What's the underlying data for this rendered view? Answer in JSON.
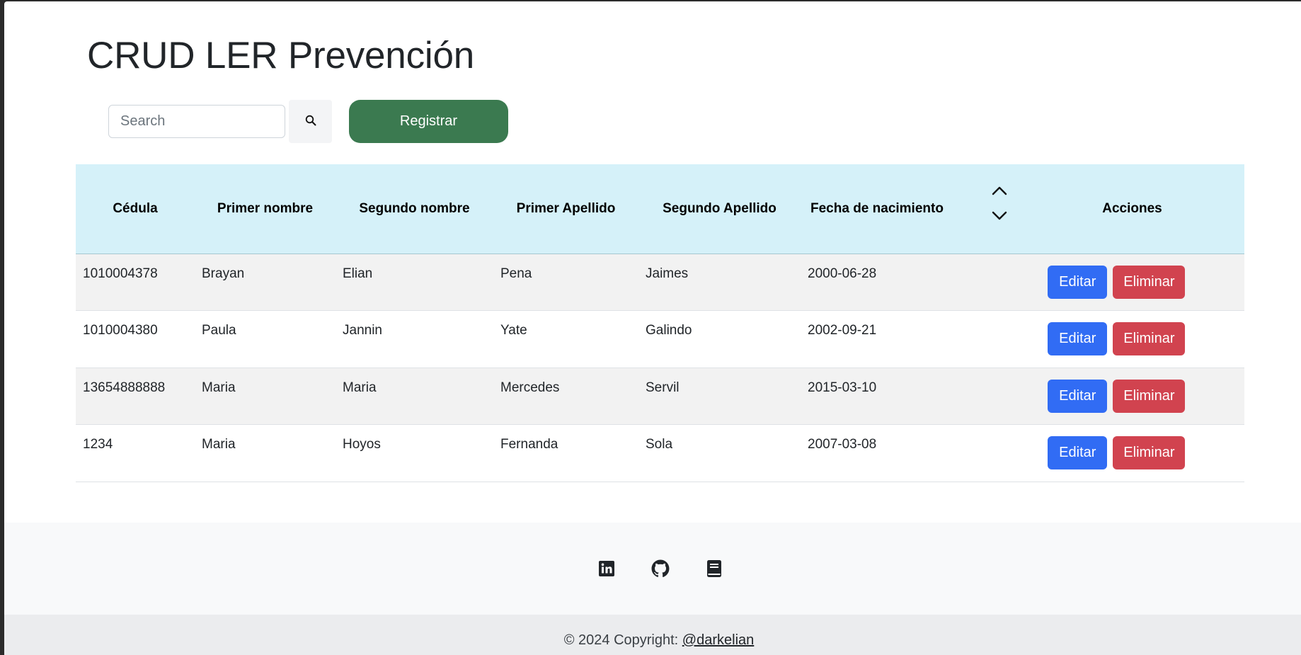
{
  "page": {
    "title": "CRUD LER Prevención"
  },
  "search": {
    "placeholder": "Search",
    "value": ""
  },
  "toolbar": {
    "register_label": "Registrar"
  },
  "table": {
    "headers": [
      "Cédula",
      "Primer nombre",
      "Segundo nombre",
      "Primer Apellido",
      "Segundo Apellido",
      "Fecha de nacimiento",
      "Acciones"
    ],
    "rows": [
      [
        "1010004378",
        "Brayan",
        "Elian",
        "Pena",
        "Jaimes",
        "2000-06-28"
      ],
      [
        "1010004380",
        "Paula",
        "Jannin",
        "Yate",
        "Galindo",
        "2002-09-21"
      ],
      [
        "13654888888",
        "Maria",
        "Maria",
        "Mercedes",
        "Servil",
        "2015-03-10"
      ],
      [
        "1234",
        "Maria",
        "Hoyos",
        "Fernanda",
        "Sola",
        "2007-03-08"
      ]
    ],
    "edit_label": "Editar",
    "delete_label": "Eliminar"
  },
  "footer": {
    "icons": [
      "linkedin-icon",
      "github-icon",
      "book-icon"
    ],
    "copyright_text": "© 2024 Copyright: ",
    "copyright_link": "@darkelian"
  },
  "colors": {
    "register": "#3b7a50",
    "edit": "#316cf4",
    "delete": "#d1434f",
    "header_bg": "#d5f1f9"
  }
}
